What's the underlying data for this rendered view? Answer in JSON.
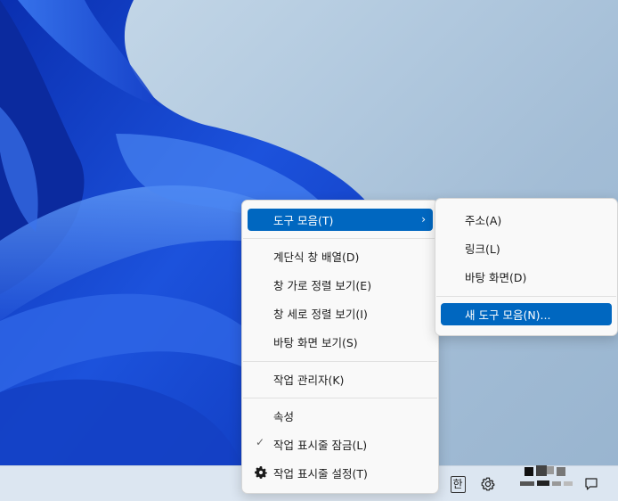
{
  "context_menu": {
    "items": [
      {
        "label": "도구 모음(T)"
      },
      {
        "label": "계단식 창 배열(D)"
      },
      {
        "label": "창 가로 정렬 보기(E)"
      },
      {
        "label": "창 세로 정렬 보기(I)"
      },
      {
        "label": "바탕 화면 보기(S)"
      },
      {
        "label": "작업 관리자(K)"
      },
      {
        "label": "속성"
      },
      {
        "label": "작업 표시줄 잠금(L)"
      },
      {
        "label": "작업 표시줄 설정(T)"
      }
    ],
    "submenu_arrow": "›",
    "checkmark": "✓"
  },
  "toolbar_submenu": {
    "items": [
      {
        "label": "주소(A)"
      },
      {
        "label": "링크(L)"
      },
      {
        "label": "바탕 화면(D)"
      },
      {
        "label": "새 도구 모음(N)..."
      }
    ]
  },
  "taskbar": {
    "ime_label": "한",
    "tray_settings_icon": "gear-icon",
    "notification_icon": "speech-bubble-icon"
  },
  "colors": {
    "highlight": "#0067c0",
    "menu_bg": "#f9f9f9",
    "taskbar_bg": "#dce6f1",
    "bloom_blue": "#1a4fd6"
  }
}
